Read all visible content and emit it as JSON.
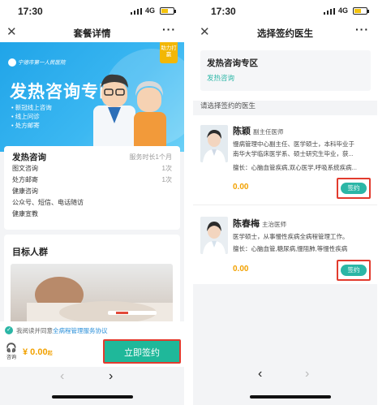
{
  "left": {
    "status": {
      "time": "17:30",
      "network": "4G"
    },
    "nav": {
      "title": "套餐详情",
      "close": "✕",
      "more": "···"
    },
    "banner": {
      "hospital": "宁德市第一人民医院",
      "title": "发热咨询专区",
      "points": [
        "• 新冠线上咨询",
        "• 线上问诊",
        "• 处方邮寄"
      ],
      "tag": "助力打赢"
    },
    "package": {
      "title": "发热咨询",
      "duration": "服务时长1个月",
      "items": [
        {
          "name": "图文咨询",
          "count": "1次"
        },
        {
          "name": "处方邮寄",
          "count": "1次"
        },
        {
          "name": "健康咨询",
          "count": ""
        },
        {
          "name": "公众号、短信、电话随访",
          "count": ""
        },
        {
          "name": "健康宣教",
          "count": ""
        }
      ]
    },
    "target": {
      "title": "目标人群"
    },
    "agreement": {
      "label": "我阅读并同意",
      "link": "全病程管理服务协议"
    },
    "bottom": {
      "cs_label": "咨询",
      "price": "¥ 0.00",
      "price_unit": "起",
      "button": "立即签约"
    },
    "pager": {
      "prev": "‹",
      "next": "›"
    }
  },
  "right": {
    "status": {
      "time": "17:30",
      "network": "4G"
    },
    "nav": {
      "title": "选择签约医生",
      "close": "✕",
      "more": "···"
    },
    "zone": {
      "title": "发热咨询专区",
      "subtitle": "发热咨询"
    },
    "choose_label": "请选择签约的医生",
    "doctors": [
      {
        "name": "陈颖",
        "title": "副主任医师",
        "desc1": "慢病管理中心副主任、医学硕士，本科毕业于",
        "desc2": "南华大学临床医学系、硕士研究生毕业，获...",
        "specialty": "擅长：心脑血管疾病,双心医学,呼吸系统疾病...",
        "price": "0.00",
        "button": "签约"
      },
      {
        "name": "陈春梅",
        "title": "主治医师",
        "desc1": "医学硕士，从事慢性疾病全病程管理工作。",
        "desc2": "",
        "specialty": "擅长：心脑血管,糖尿病,慢阻肺,等慢性疾病",
        "price": "0.00",
        "button": "签约"
      }
    ],
    "pager": {
      "prev": "‹",
      "next": "›"
    }
  },
  "colors": {
    "accent": "#2bb6a6",
    "price": "#f2a100",
    "highlight": "#e23b2e",
    "banner": "#2aa8ec"
  }
}
